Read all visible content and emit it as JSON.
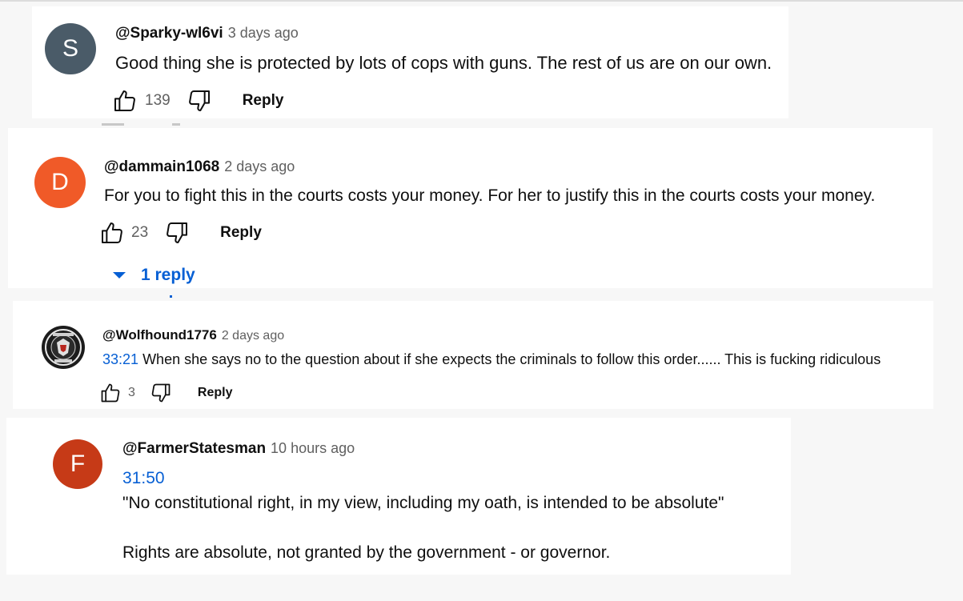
{
  "comments": [
    {
      "avatar_letter": "S",
      "avatar_color": "#4a5b68",
      "author": "@Sparky-wl6vi",
      "time": "3 days ago",
      "likes": "139",
      "reply_label": "Reply",
      "text": "Good thing she is protected by lots of cops with guns. The rest of us are on our own."
    },
    {
      "avatar_letter": "D",
      "avatar_color": "#f05a28",
      "author": "@dammain1068",
      "time": "2 days ago",
      "likes": "23",
      "reply_label": "Reply",
      "text": "For you to fight this in the courts costs your money. For her to justify this in the courts costs your money.",
      "replies_label": "1 reply"
    },
    {
      "avatar_letter": "",
      "avatar_color": "#1c1c1c",
      "author": "@Wolfhound1776",
      "time": "2 days ago",
      "likes": "3",
      "reply_label": "Reply",
      "timestamp_link": "33:21",
      "text": "When she says no to the question about if she expects the criminals to follow this order...... This is fucking ridiculous"
    },
    {
      "avatar_letter": "F",
      "avatar_color": "#c63a17",
      "author": "@FarmerStatesman",
      "time": "10 hours ago",
      "timestamp_link": "31:50",
      "line1": "\"No constitutional right, in my view, including my oath, is intended to be absolute\"",
      "line2": "Rights are absolute, not granted by the government - or governor."
    }
  ]
}
